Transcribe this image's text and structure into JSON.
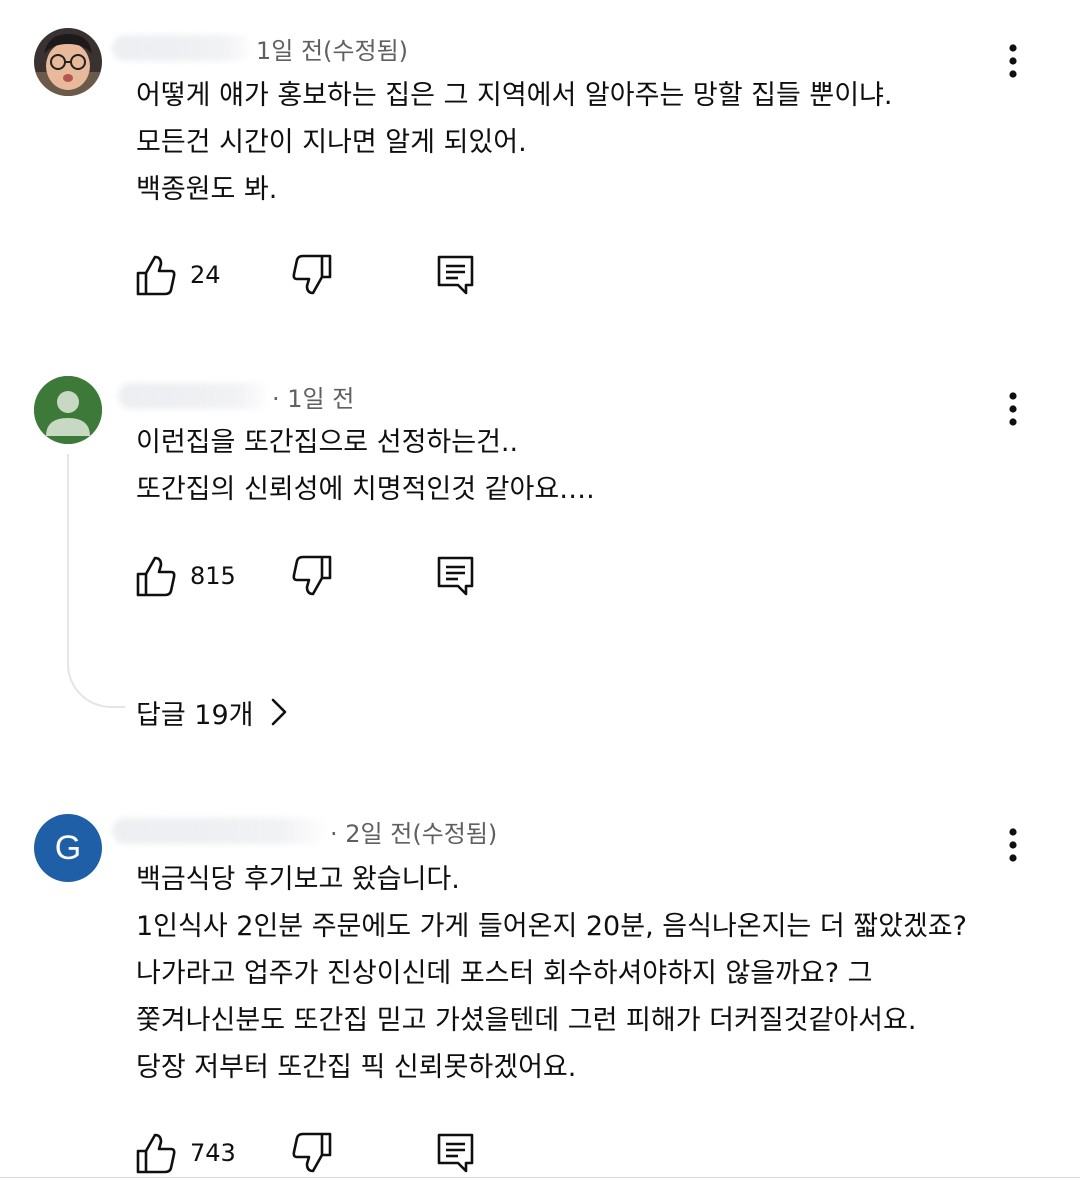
{
  "comments": [
    {
      "time": "1일 전(수정됨)",
      "lines": [
        "어떻게 얘가 홍보하는 집은 그 지역에서 알아주는 망할 집들 뿐이냐.",
        "모든건 시간이 지나면 알게 되있어.",
        "백종원도 봐."
      ],
      "likes": "24"
    },
    {
      "time": "· 1일 전",
      "lines": [
        "이런집을 또간집으로 선정하는건..",
        "또간집의 신뢰성에 치명적인것 같아요…."
      ],
      "likes": "815",
      "replies_label": "답글 19개"
    },
    {
      "avatar_letter": "G",
      "time": "· 2일 전(수정됨)",
      "lines": [
        "백금식당 후기보고 왔습니다.",
        "1인식사 2인분 주문에도 가게 들어온지 20분, 음식나온지는 더 짧았겠죠?",
        "나가라고 업주가 진상이신데 포스터 회수하셔야하지 않을까요? 그",
        "쫓겨나신분도 또간집 믿고 가셨을텐데 그런 피해가 더커질것같아서요.",
        "당장 저부터 또간집 픽 신뢰못하겠어요."
      ],
      "likes": "743"
    }
  ],
  "colors": {
    "avatar_green": "#3d7a3a",
    "avatar_blue": "#1e5fa8",
    "meta_text": "#606060",
    "body_text": "#0f0f0f"
  },
  "icons": [
    "like-icon",
    "dislike-icon",
    "reply-icon",
    "more-vert-icon",
    "chevron-right-icon",
    "person-icon"
  ]
}
